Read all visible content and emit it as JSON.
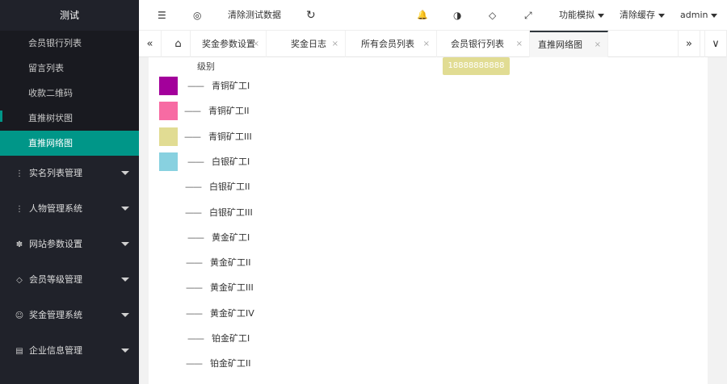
{
  "app": {
    "title": "测试"
  },
  "sidebar": {
    "sub_items": [
      {
        "label": "会员银行列表"
      },
      {
        "label": "留言列表"
      },
      {
        "label": "收款二维码"
      },
      {
        "label": "直推树状图"
      },
      {
        "label": "直推网络图"
      }
    ],
    "groups": [
      {
        "label": "实名列表管理",
        "icon": "⋮"
      },
      {
        "label": "人物管理系统",
        "icon": "⋮"
      },
      {
        "label": "网站参数设置",
        "icon": "✽"
      },
      {
        "label": "会员等级管理",
        "icon": "◇"
      },
      {
        "label": "奖金管理系统",
        "icon": "☺"
      },
      {
        "label": "企业信息管理",
        "icon": "▤"
      }
    ]
  },
  "header": {
    "menu_icon": "☰",
    "globe_icon": "◎",
    "clear_test_data": "清除测试数据",
    "refresh_icon": "↻",
    "bell_icon": "🔔",
    "theme_icon": "◑",
    "tag_icon": "◇",
    "fullscreen_icon": "⤢",
    "func_mode": "功能模拟",
    "clear_cache": "清除缓存",
    "user": "admin"
  },
  "tabs": {
    "prev_icon": "«",
    "home_icon": "⌂",
    "next_icon": "»",
    "more_icon": "∨",
    "close_icon": "×",
    "items": [
      {
        "label": "奖金参数设置"
      },
      {
        "label": "奖金日志"
      },
      {
        "label": "所有会员列表"
      },
      {
        "label": "会员银行列表"
      },
      {
        "label": "直推网络图"
      }
    ]
  },
  "content": {
    "level_label": "级别",
    "tooltip": "18888888888",
    "dash": "——",
    "legend": [
      {
        "label": "青铜矿工I",
        "color": "#a3009b"
      },
      {
        "label": "青铜矿工II",
        "color": "#f76ba3"
      },
      {
        "label": "青铜矿工III",
        "color": "#e1dc93"
      },
      {
        "label": "白银矿工I",
        "color": "#88d1e0"
      },
      {
        "label": "白银矿工II",
        "color": ""
      },
      {
        "label": "白银矿工III",
        "color": ""
      },
      {
        "label": "黄金矿工I",
        "color": ""
      },
      {
        "label": "黄金矿工II",
        "color": ""
      },
      {
        "label": "黄金矿工III",
        "color": ""
      },
      {
        "label": "黄金矿工IV",
        "color": ""
      },
      {
        "label": "铂金矿工I",
        "color": ""
      },
      {
        "label": "铂金矿工II",
        "color": ""
      }
    ]
  },
  "colors": {
    "sidebar_bg": "#20222a",
    "accent": "#009688"
  }
}
